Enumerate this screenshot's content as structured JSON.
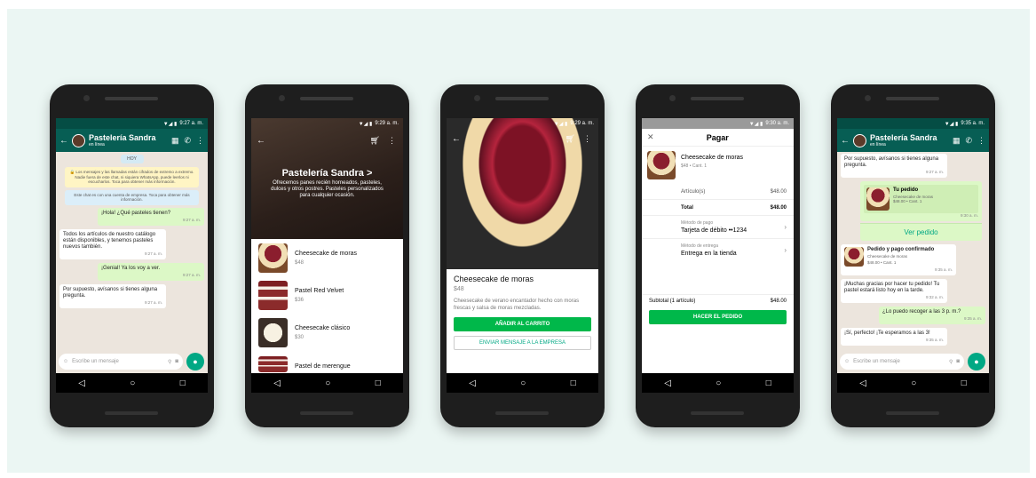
{
  "phone1": {
    "time": "9:27 a. m.",
    "header": {
      "title": "Pastelería Sandra",
      "subtitle": "en línea"
    },
    "today": "HOY",
    "system_message": "🔒 Los mensajes y las llamadas están cifrados de extremo a extremo. Nadie fuera de este chat, ni siquiera WhatsApp, puede leerlos ni escucharlos. Toca para obtener más información.",
    "business_notice": "Este chat es con una cuenta de empresa. Toca para obtener más información.",
    "messages": [
      {
        "dir": "out",
        "text": "¡Hola! ¿Qué pasteles tienen?",
        "time": "9:27 a. m."
      },
      {
        "dir": "in",
        "text": "Todos los artículos de nuestro catálogo están disponibles, y tenemos pasteles nuevos también.",
        "time": "9:27 a. m."
      },
      {
        "dir": "out",
        "text": "¡Genial! Ya los voy a ver.",
        "time": "9:27 a. m."
      },
      {
        "dir": "in",
        "text": "Por supuesto, avísanos si tienes alguna pregunta.",
        "time": "9:27 a. m."
      }
    ],
    "composer_placeholder": "Escribe un mensaje"
  },
  "phone2": {
    "time": "9:29 a. m.",
    "shop_title": "Pastelería Sandra >",
    "shop_desc": "Ofrecemos panes recién horneados, pasteles, dulces y otros postres. Pasteles personalizados para cualquier ocasión.",
    "products": [
      {
        "name": "Cheesecake de moras",
        "price": "$48"
      },
      {
        "name": "Pastel Red Velvet",
        "price": "$36"
      },
      {
        "name": "Cheesecake clásico",
        "price": "$30"
      },
      {
        "name": "Pastel de merengue",
        "price": ""
      }
    ]
  },
  "phone3": {
    "time": "9:29 a. m.",
    "product_name": "Cheesecake de moras",
    "price": "$48",
    "description": "Cheesecake de verano encantador hecho con moras frescas y salsa de moras mezcladas.",
    "add_to_cart": "AÑADIR AL CARRITO",
    "message_business": "ENVIAR MENSAJE A LA EMPRESA"
  },
  "phone4": {
    "time": "9:30 a. m.",
    "title": "Pagar",
    "item_name": "Cheesecake de moras",
    "item_meta": "$48 • Cant. 1",
    "articles_label": "Artículo(s)",
    "articles_value": "$48.00",
    "total_label": "Total",
    "total_value": "$48.00",
    "payment_label": "Método de pago",
    "payment_value": "Tarjeta de débito ••1234",
    "delivery_label": "Método de entrega",
    "delivery_value": "Entrega en la tienda",
    "subtotal_label": "Subtotal (1 artículo)",
    "subtotal_value": "$48.00",
    "place_order": "HACER EL PEDIDO"
  },
  "phone5": {
    "time": "9:35 a. m.",
    "header": {
      "title": "Pastelería Sandra",
      "subtitle": "en línea"
    },
    "msg_top": {
      "text": "Por supuesto, avísanos si tienes alguna pregunta.",
      "time": "9:27 a. m."
    },
    "order": {
      "title": "Tu pedido",
      "item": "Cheesecake de moras",
      "meta": "$48.00 • Cant. 1",
      "time": "9:30 a. m.",
      "view": "Ver pedido"
    },
    "confirmed": {
      "title": "Pedido y pago confirmado",
      "item": "Cheesecake de moras",
      "meta": "$48.00 • Cant. 1",
      "time": "9:35 a. m."
    },
    "messages": [
      {
        "dir": "in",
        "text": "¡Muchas gracias por hacer tu pedido! Tu pastel estará listo hoy en la tarde.",
        "time": "9:32 a. m."
      },
      {
        "dir": "out",
        "text": "¿Lo puedo recoger a las 3 p. m.?",
        "time": "9:35 a. m."
      },
      {
        "dir": "in",
        "text": "¡Sí, perfecto! ¡Te esperamos a las 3!",
        "time": "9:35 a. m."
      }
    ],
    "composer_placeholder": "Escribe un mensaje"
  },
  "nav": {
    "back": "◁",
    "home": "○",
    "recent": "□"
  }
}
